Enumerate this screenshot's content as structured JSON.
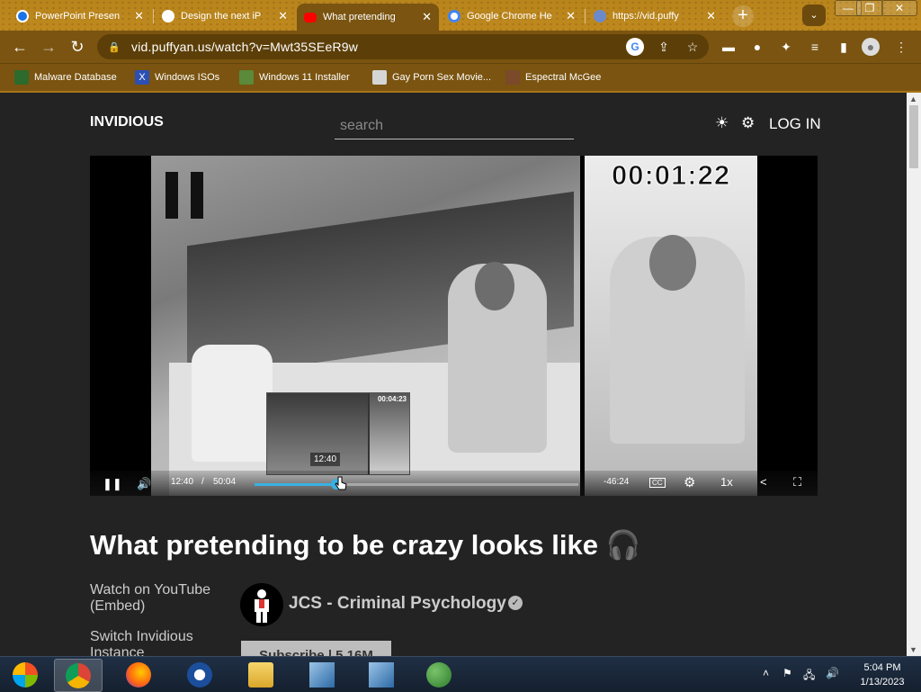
{
  "browser": {
    "tabs": [
      {
        "title": "PowerPoint Presen",
        "favicon": "chrome-icon",
        "color": "#1a73e8"
      },
      {
        "title": "Design the next iP",
        "favicon": "steam-icon",
        "color": "#ffffff"
      },
      {
        "title": "What pretending",
        "favicon": "youtube-icon",
        "color": "#ff0000"
      },
      {
        "title": "Google Chrome He",
        "favicon": "google-icon",
        "color": "#4285f4"
      },
      {
        "title": "https://vid.puffy",
        "favicon": "invidious-icon",
        "color": "#6b8acb"
      }
    ],
    "new_tab": "+",
    "url": "vid.puffyan.us/watch?v=Mwt35SEeR9w",
    "window_controls": {
      "minimize": "—",
      "restore": "❐",
      "close": "✕"
    },
    "bookmarks": [
      {
        "label": "Malware Database",
        "color": "#2d6a2d"
      },
      {
        "label": "Windows ISOs",
        "color": "#2b4fb5"
      },
      {
        "label": "Windows 11 Installer",
        "color": "#5a8a3a"
      },
      {
        "label": "Gay Porn Sex Movie...",
        "color": "#d5d5d5"
      },
      {
        "label": "Espectral McGee",
        "color": "#7a4a2a"
      }
    ]
  },
  "site": {
    "brand": "INVIDIOUS",
    "search_placeholder": "search",
    "login": "LOG IN"
  },
  "player": {
    "timestamp_overlay": "00:01:22",
    "preview_stamp": "00:04:23",
    "preview_time": "12:40",
    "current_time": "12:40",
    "separator": "/",
    "duration": "50:04",
    "remaining": "-46:24",
    "speed": "1x",
    "progress_fraction": 0.253
  },
  "video": {
    "title": "What pretending to be crazy looks like",
    "watch_on_youtube": "Watch on YouTube",
    "embed": "Embed",
    "switch_instance": "Switch Invidious Instance",
    "channel": "JCS - Criminal Psychology",
    "subscribe": "Subscribe | 5.16M"
  },
  "taskbar": {
    "time": "5:04 PM",
    "date": "1/13/2023",
    "apps": [
      "windows-start",
      "chrome",
      "firefox",
      "obama-campaign",
      "file-explorer",
      "remote-desktop",
      "remote-desktop-2",
      "network-users"
    ]
  }
}
